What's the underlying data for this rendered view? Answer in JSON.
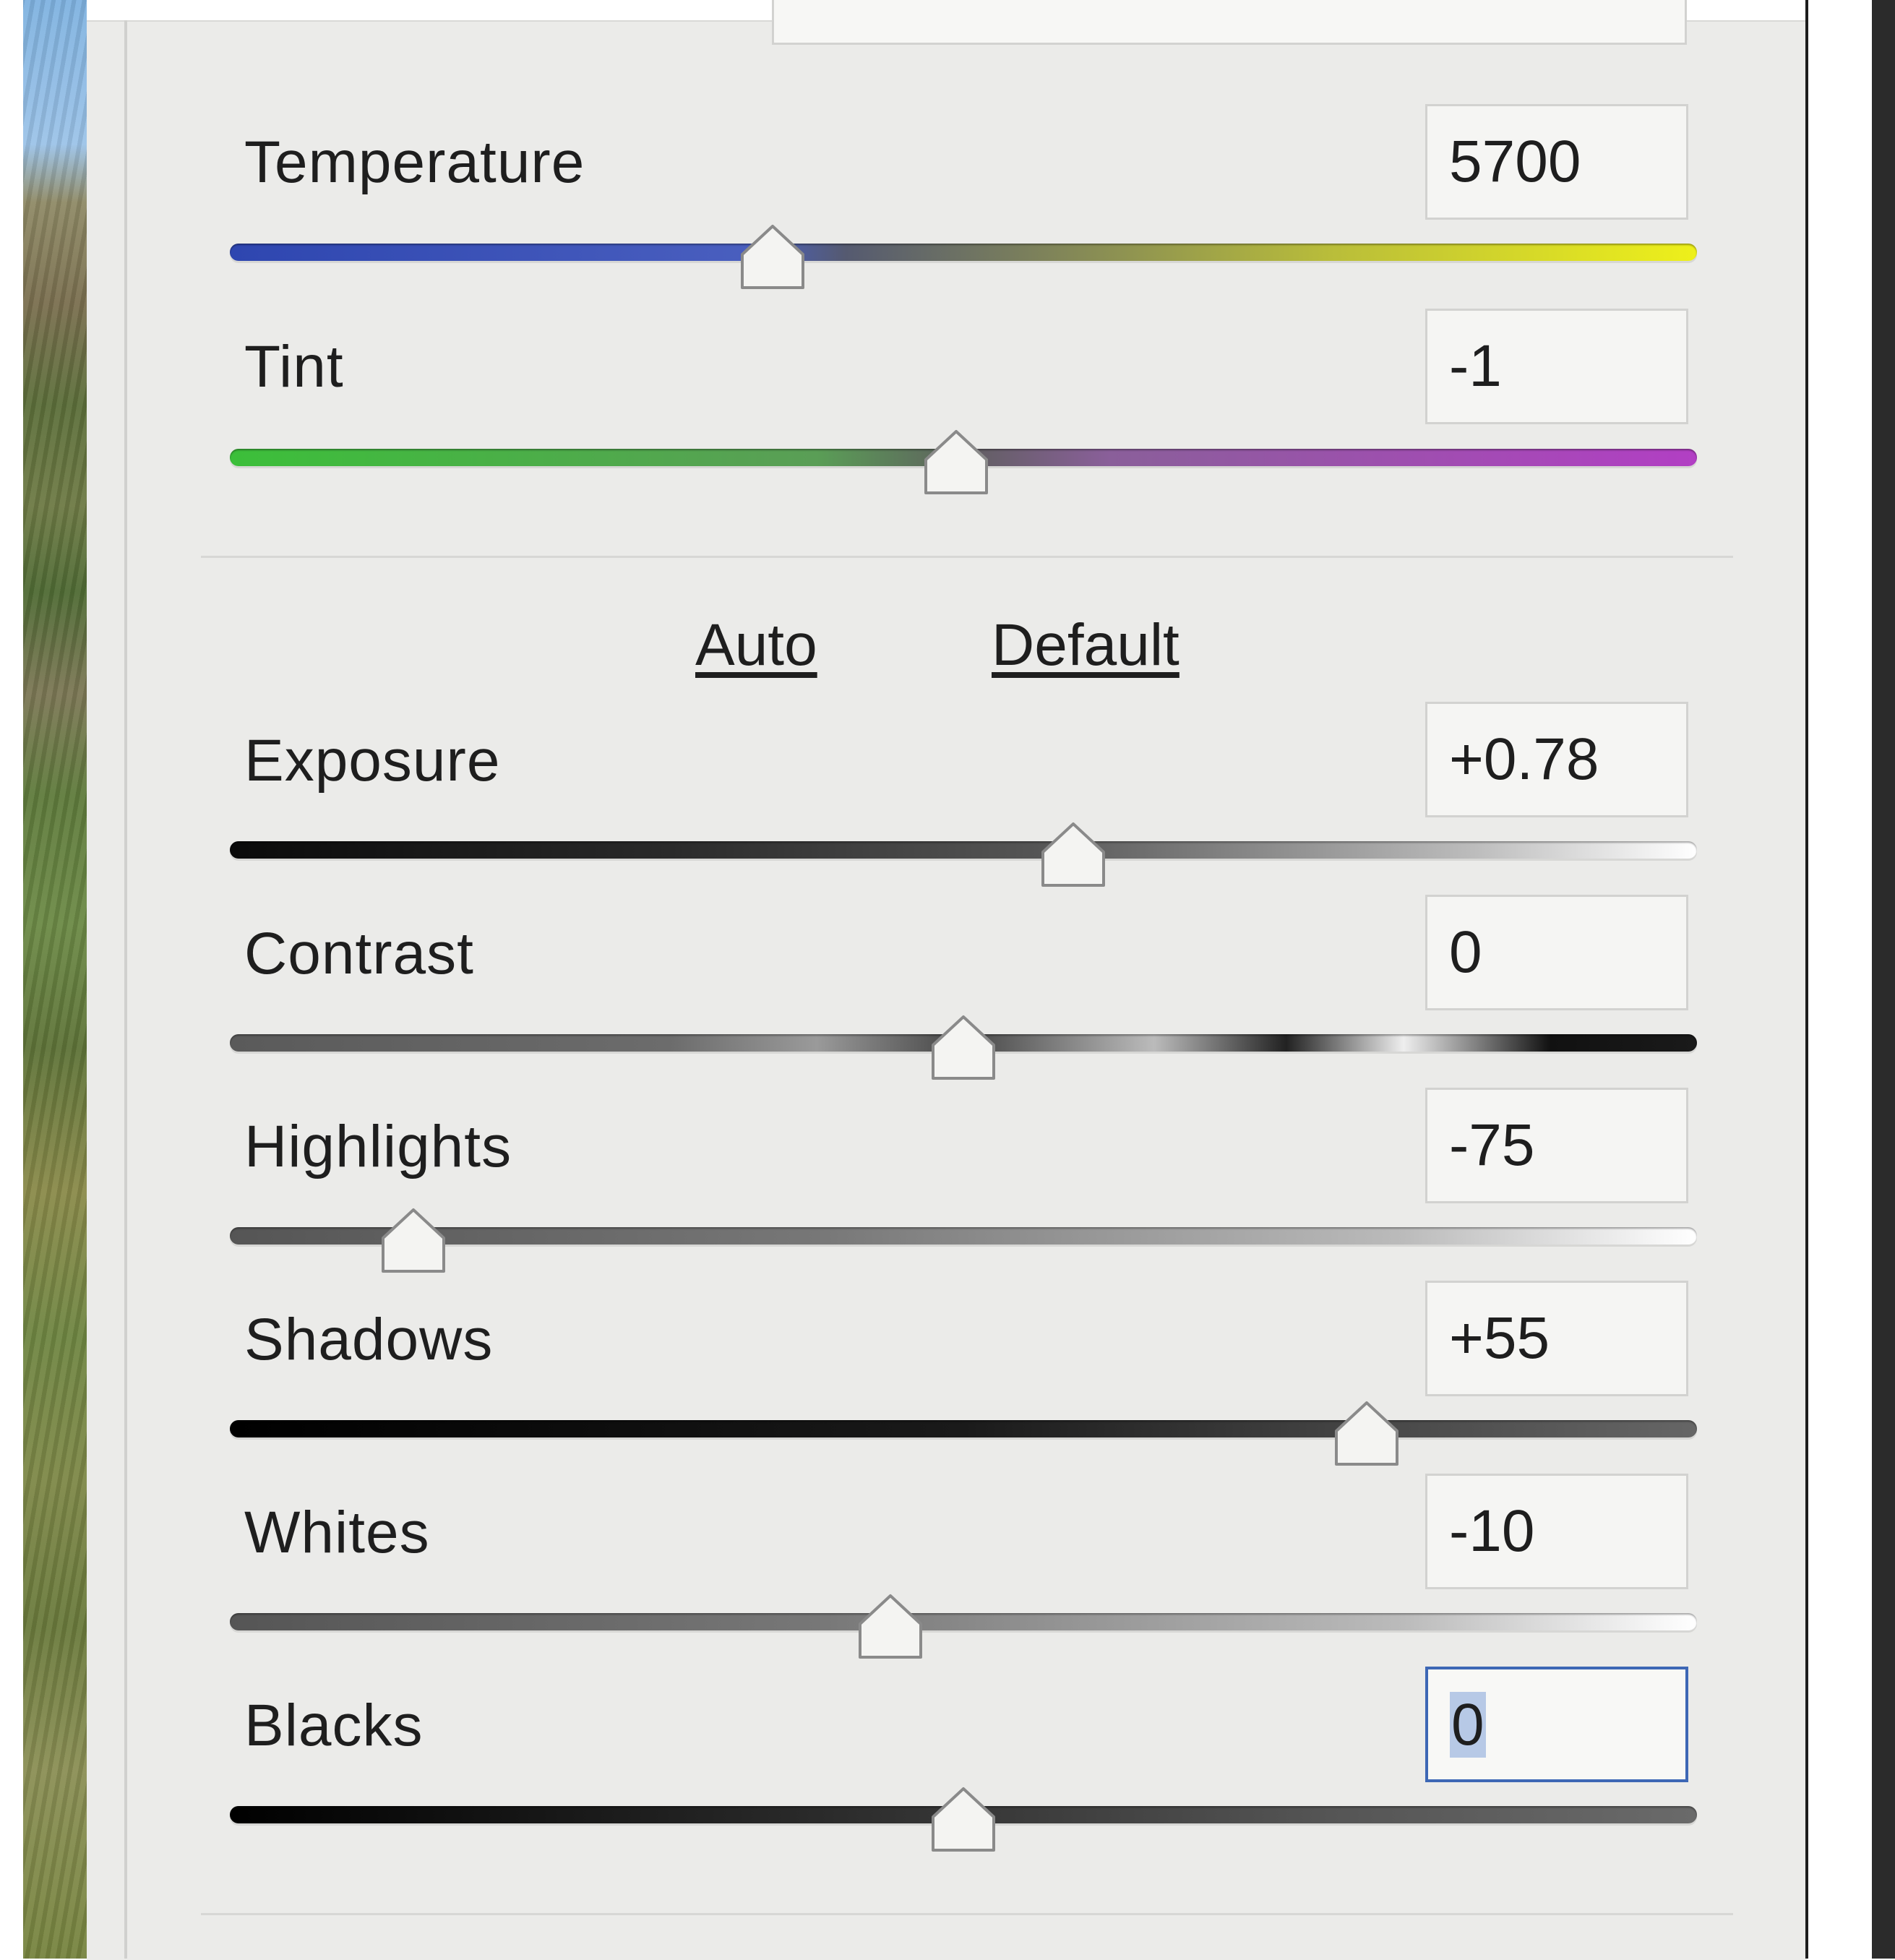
{
  "basic_panel": {
    "sliders": [
      {
        "id": "temperature",
        "label": "Temperature",
        "value": "5700",
        "position": 0.37,
        "track": "temperature"
      },
      {
        "id": "tint",
        "label": "Tint",
        "value": "-1",
        "position": 0.495,
        "track": "tint"
      }
    ],
    "actions": {
      "auto_label": "Auto",
      "default_label": "Default"
    },
    "tone_sliders": [
      {
        "id": "exposure",
        "label": "Exposure",
        "value": "+0.78",
        "position": 0.575,
        "track": "exposure"
      },
      {
        "id": "contrast",
        "label": "Contrast",
        "value": "0",
        "position": 0.5,
        "track": "contrast"
      },
      {
        "id": "highlights",
        "label": "Highlights",
        "value": "-75",
        "position": 0.125,
        "track": "highlights"
      },
      {
        "id": "shadows",
        "label": "Shadows",
        "value": "+55",
        "position": 0.775,
        "track": "shadows"
      },
      {
        "id": "whites",
        "label": "Whites",
        "value": "-10",
        "position": 0.45,
        "track": "whites"
      },
      {
        "id": "blacks",
        "label": "Blacks",
        "value": "0",
        "position": 0.5,
        "track": "blacks",
        "focused": true
      }
    ]
  },
  "colors": {
    "panel_bg": "#ebebe9",
    "focus_border": "#3d67b5",
    "temperature_track": [
      "#2e46b0",
      "#4a5fbf",
      "#b9bd3a",
      "#eef01a"
    ],
    "tint_track": [
      "#3cbf3a",
      "#5a9e56",
      "#8a5f9a",
      "#b23fc4"
    ]
  }
}
